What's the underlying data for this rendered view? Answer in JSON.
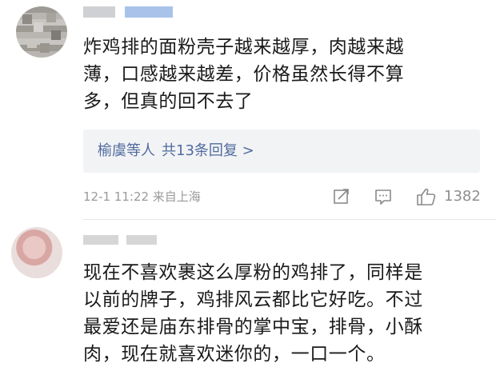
{
  "comments": [
    {
      "text_lines": [
        "炸鸡排的面粉壳子越来越厚，肉越来越",
        "薄，口感越来越差，价格虽然长得不算",
        "多，但真的回不去了"
      ],
      "replies": {
        "names": "榆虞等人",
        "count_text": "共13条回复 >"
      },
      "meta": {
        "time_location": "12-1 11:22 来自上海",
        "like_count": "1382"
      },
      "icons": [
        "share-icon",
        "comment-icon",
        "like-icon"
      ]
    },
    {
      "text_lines": [
        "现在不喜欢裹这么厚粉的鸡排了，同样是",
        "以前的牌子，鸡排风云都比它好吃。不过",
        "最爱还是庙东排骨的掌中宝，排骨，小酥",
        "肉，现在就喜欢迷你的，一口一个。"
      ]
    }
  ],
  "colors": {
    "link_blue": "#506b9e",
    "meta_gray": "#9a9a9a",
    "reply_bg": "#f2f3f5"
  }
}
